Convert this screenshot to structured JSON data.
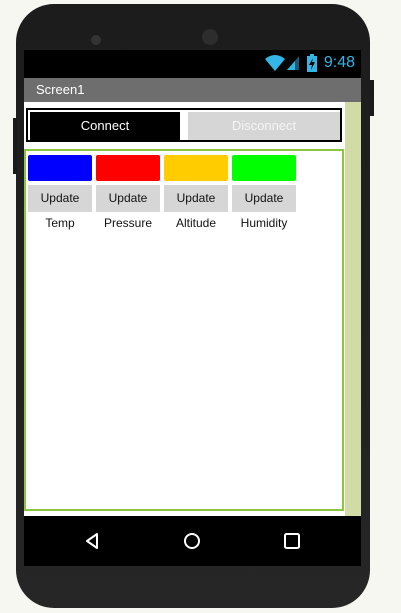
{
  "status_bar": {
    "time": "9:48"
  },
  "title_bar": {
    "title": "Screen1"
  },
  "controls": {
    "connect_label": "Connect",
    "disconnect_label": "Disconnect"
  },
  "sensors": [
    {
      "name": "Temp",
      "color": "#0000ff",
      "button_label": "Update"
    },
    {
      "name": "Pressure",
      "color": "#ff0000",
      "button_label": "Update"
    },
    {
      "name": "Altitude",
      "color": "#ffcc00",
      "button_label": "Update"
    },
    {
      "name": "Humidity",
      "color": "#00ff00",
      "button_label": "Update"
    }
  ],
  "nav_bar": {
    "icons": [
      "back-icon",
      "home-icon",
      "recents-icon"
    ]
  },
  "colors": {
    "accent_time": "#33b5e5",
    "title_bar": "#6e6e6e",
    "border_green": "#8cc63f"
  }
}
